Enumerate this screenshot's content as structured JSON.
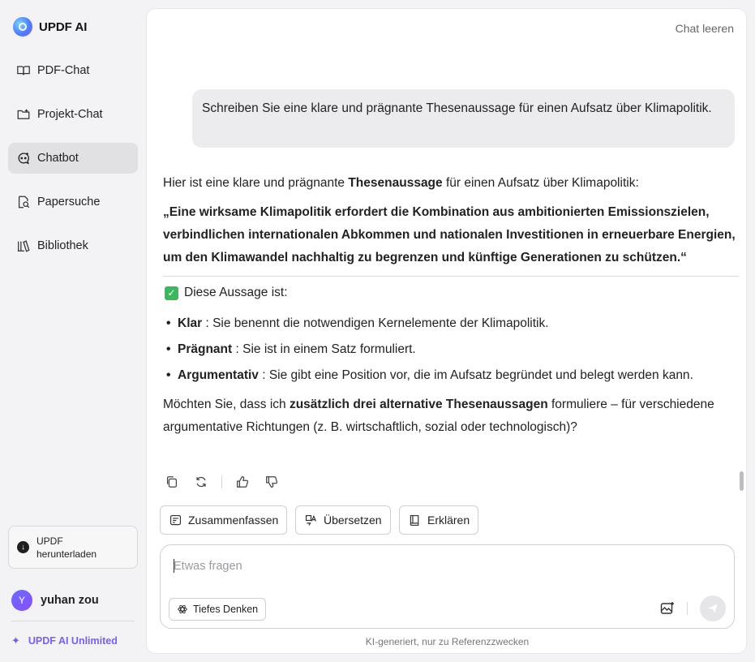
{
  "brand": {
    "name": "UPDF AI"
  },
  "sidebar": {
    "items": [
      {
        "label": "PDF-Chat",
        "icon": "book-open-icon",
        "active": false
      },
      {
        "label": "Projekt-Chat",
        "icon": "folder-chat-icon",
        "active": false
      },
      {
        "label": "Chatbot",
        "icon": "chat-bot-icon",
        "active": true
      },
      {
        "label": "Papersuche",
        "icon": "search-paper-icon",
        "active": false
      },
      {
        "label": "Bibliothek",
        "icon": "library-icon",
        "active": false
      }
    ],
    "download": {
      "line1": "UPDF",
      "line2": "herunterladen"
    },
    "user": {
      "initial": "Y",
      "name": "yuhan zou"
    },
    "unlimited_label": "UPDF AI Unlimited"
  },
  "header": {
    "clear_chat": "Chat leeren"
  },
  "conversation": {
    "user_message": "Schreiben Sie eine klare und prägnante Thesenaussage für einen Aufsatz über Klimapolitik.",
    "answer": {
      "intro_pre": "Hier ist eine klare und prägnante ",
      "intro_bold": "Thesenaussage",
      "intro_post": " für einen Aufsatz über Klimapolitik:",
      "thesis": "„Eine wirksame Klimapolitik erfordert die Kombination aus ambitionierten Emissionszielen, verbindlichen internationalen Abkommen und nationalen Investitionen in erneuerbare Energien, um den Klimawandel nachhaltig zu begrenzen und künftige Generationen zu schützen.“",
      "check_label": "Diese Aussage ist:",
      "bullets": [
        {
          "term": "Klar",
          "text": " : Sie benennt die notwendigen Kernelemente der Klimapolitik."
        },
        {
          "term": "Prägnant",
          "text": " : Sie ist in einem Satz formuliert."
        },
        {
          "term": "Argumentativ",
          "text": " : Sie gibt eine Position vor, die im Aufsatz begründet und belegt werden kann."
        }
      ],
      "closing_pre": "Möchten Sie, dass ich ",
      "closing_bold": "zusätzlich drei alternative Thesenaussagen",
      "closing_post": " formuliere – für verschiedene argumentative Richtungen (z. B. wirtschaftlich, sozial oder technologisch)?"
    }
  },
  "quick_actions": [
    "Zusammenfassen",
    "Übersetzen",
    "Erklären"
  ],
  "composer": {
    "placeholder": "Etwas fragen",
    "value": "",
    "deep_think_label": "Tiefes Denken"
  },
  "footer": {
    "disclaimer": "KI-generiert, nur zu Referenzzwecken"
  }
}
